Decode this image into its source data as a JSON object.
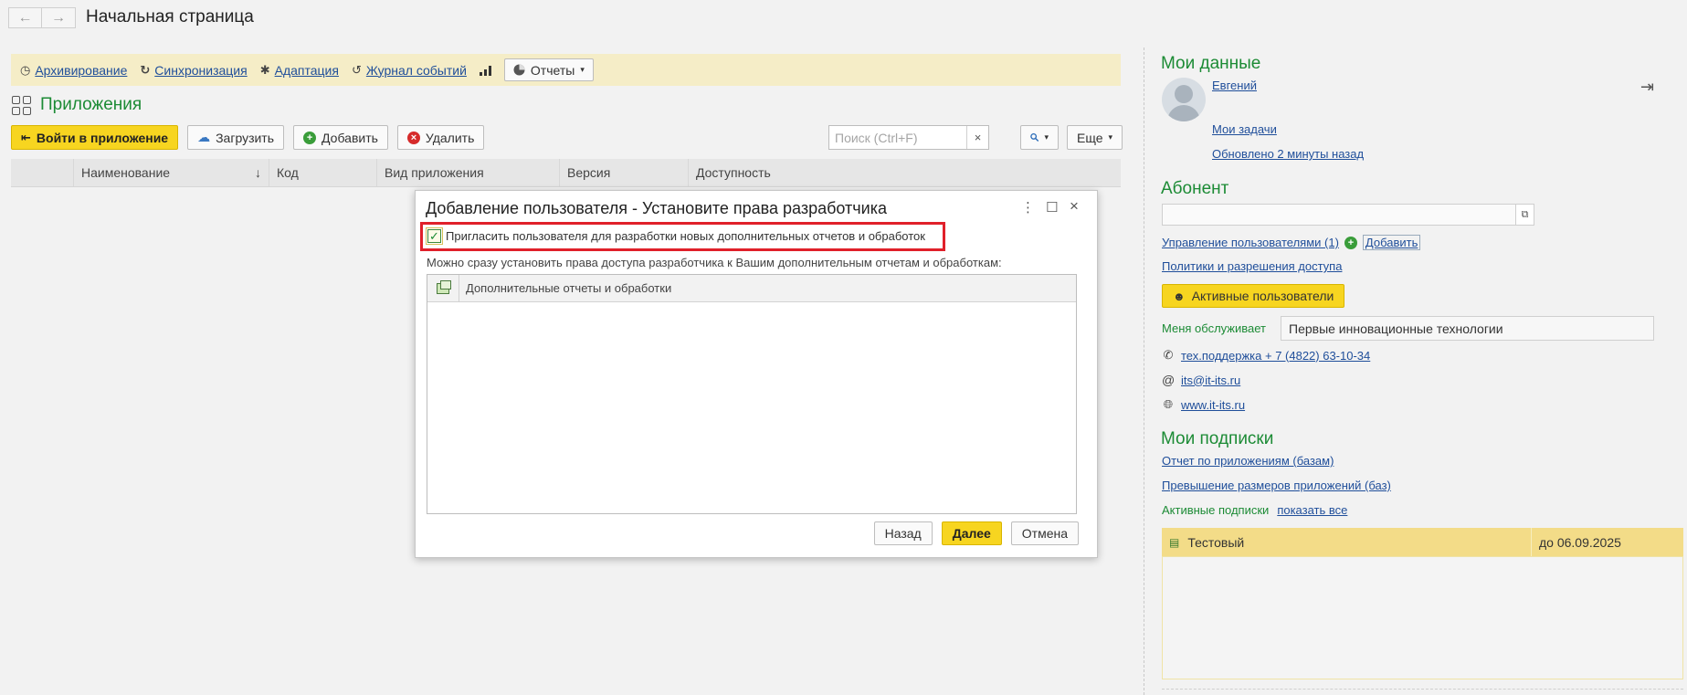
{
  "window": {
    "back_icon": "arrow-left-icon",
    "forward_icon": "arrow-right-icon",
    "title": "Начальная страница"
  },
  "left_toolbar": {
    "items": [
      {
        "icon": "clock-icon",
        "label": "Архивирование"
      },
      {
        "icon": "refresh-icon",
        "label": "Синхронизация"
      },
      {
        "icon": "puzzle-icon",
        "label": "Адаптация"
      },
      {
        "icon": "history-icon",
        "label": "Журнал событий"
      }
    ],
    "chart_icon": "bar-chart-icon",
    "reports_label": "Отчеты"
  },
  "applications": {
    "title": "Приложения",
    "buttons": {
      "enter": "Войти в приложение",
      "upload": "Загрузить",
      "add": "Добавить",
      "delete": "Удалить",
      "more": "Еще"
    },
    "search": {
      "placeholder": "Поиск (Ctrl+F)",
      "clear": "×"
    },
    "columns": [
      "Наименование",
      "Код",
      "Вид приложения",
      "Версия",
      "Доступность"
    ],
    "sort_indicator": "↓"
  },
  "my_data": {
    "title": "Мои данные",
    "user_name": "Евгений",
    "my_tasks": "Мои задачи",
    "updated": "Обновлено 2 минуты назад"
  },
  "subscriber": {
    "title": "Абонент",
    "field_value": "",
    "manage_users": "Управление пользователями (1)",
    "add": "Добавить",
    "policies": "Политики и разрешения доступа",
    "active_users_btn": "Активные пользователи",
    "served_by_label": "Меня обслуживает",
    "served_by_value": "Первые инновационные технологии",
    "phone": "тех.поддержка + 7 (4822) 63-10-34",
    "email": "its@it-its.ru",
    "website": "www.it-its.ru"
  },
  "subscriptions": {
    "title": "Мои подписки",
    "report_apps": "Отчет по приложениям (базам)",
    "oversize": "Превышение размеров приложений (баз)",
    "active_label": "Активные подписки",
    "show_all": "показать все",
    "rows": [
      {
        "name": "Тестовый",
        "until": "до 06.09.2025"
      }
    ]
  },
  "dialog": {
    "title": "Добавление пользователя - Установите права разработчика",
    "checkbox_label": "Пригласить пользователя для разработки новых дополнительных отчетов и обработок",
    "checkbox_checked": true,
    "note": "Можно сразу установить права доступа разработчика к Вашим дополнительным отчетам и обработкам:",
    "table_header": "Дополнительные отчеты и обработки",
    "buttons": {
      "back": "Назад",
      "next": "Далее",
      "cancel": "Отмена"
    }
  },
  "colors": {
    "accent_green": "#1c8b35",
    "yellow_button": "#f7d520",
    "toolbar_strip": "#f5edc7",
    "highlight_red": "#e0202a"
  }
}
